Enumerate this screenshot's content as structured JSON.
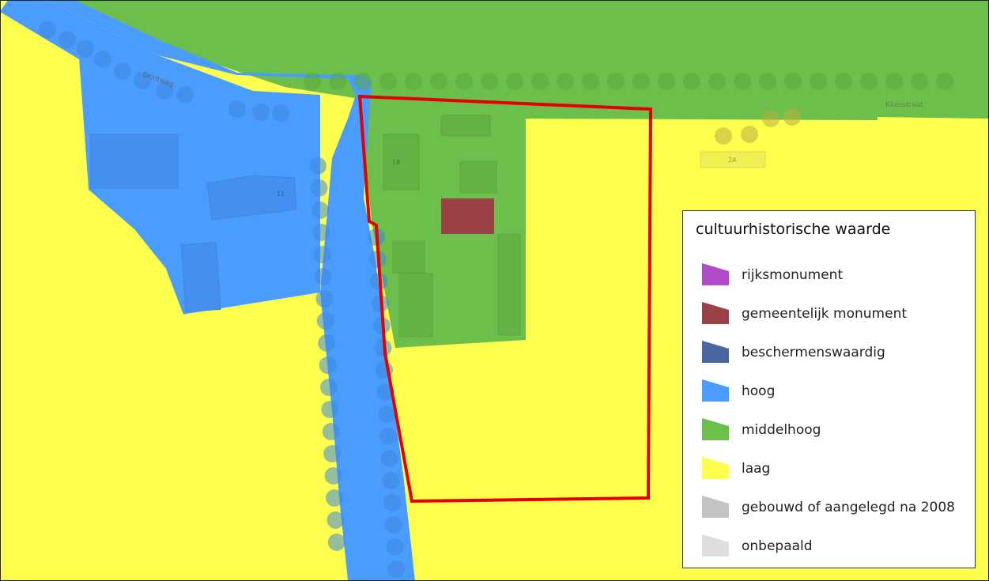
{
  "map": {
    "street_labels": [
      "Grintweg",
      "Kluisstraat"
    ],
    "house_numbers": [
      "11",
      "18",
      "2A"
    ]
  },
  "legend": {
    "title": "cultuurhistorische waarde",
    "items": [
      {
        "label": "rijksmonument",
        "color": "#b04cc8"
      },
      {
        "label": "gemeentelijk monument",
        "color": "#9b4249"
      },
      {
        "label": "beschermenswaardig",
        "color": "#4a66a0"
      },
      {
        "label": "hoog",
        "color": "#4a9cff"
      },
      {
        "label": "middelhoog",
        "color": "#6cbf4a"
      },
      {
        "label": "laag",
        "color": "#ffff4d"
      },
      {
        "label": "gebouwd of aangelegd na 2008",
        "color": "#c3c3c3"
      },
      {
        "label": "onbepaald",
        "color": "#dedede"
      }
    ]
  },
  "colors": {
    "hoog": "#4a9cff",
    "middelhoog": "#6cbf4a",
    "laag": "#ffff4d",
    "parcel_outline": "#e30000",
    "gemeentelijk_monument": "#9b4249"
  }
}
